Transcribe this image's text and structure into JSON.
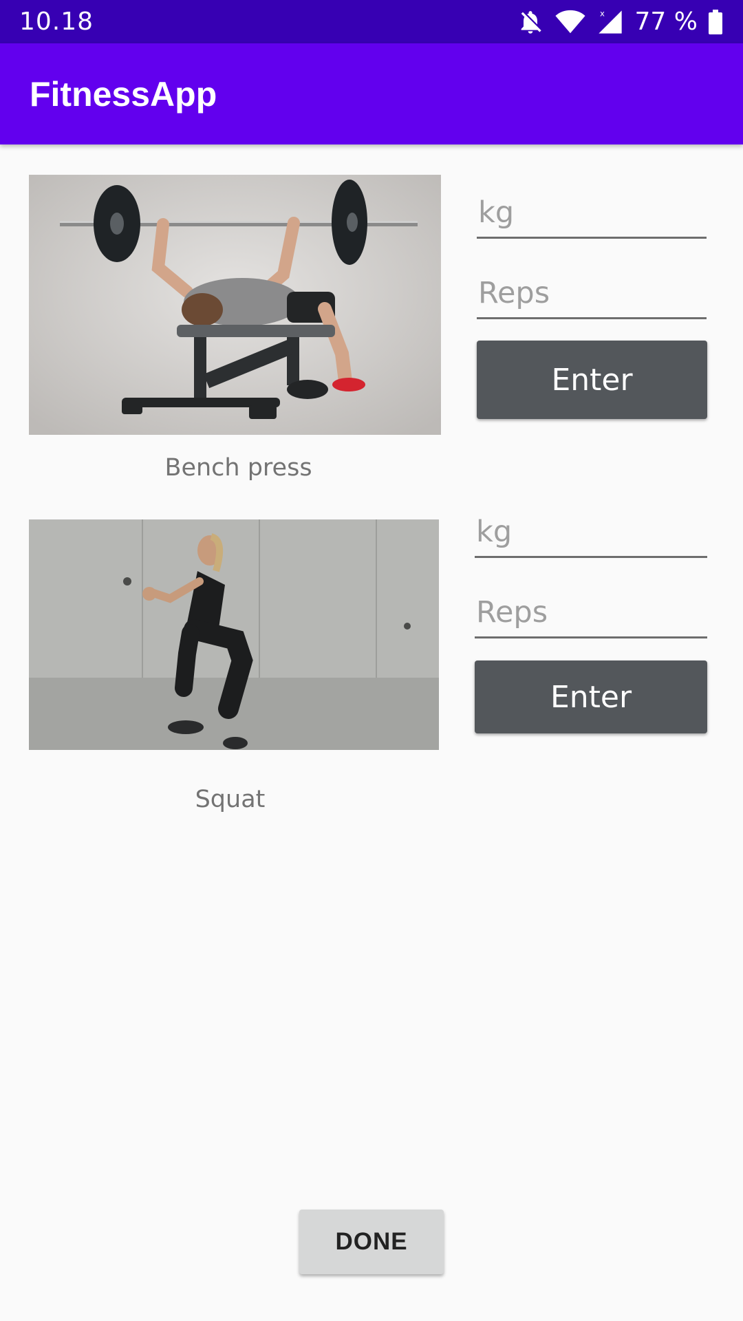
{
  "status_bar": {
    "time": "10.18",
    "battery": "77 %",
    "icons": [
      "notifications-off-icon",
      "wifi-icon",
      "cell-signal-icon",
      "battery-icon"
    ]
  },
  "app_bar": {
    "title": "FitnessApp"
  },
  "exercises": [
    {
      "name": "Bench press",
      "image_icon": "bench-press-photo",
      "weight_placeholder": "kg",
      "reps_placeholder": "Reps",
      "button_label": "Enter"
    },
    {
      "name": "Squat",
      "image_icon": "squat-photo",
      "weight_placeholder": "kg",
      "reps_placeholder": "Reps",
      "button_label": "Enter"
    }
  ],
  "done_label": "DONE",
  "colors": {
    "status_bar": "#3700b3",
    "app_bar": "#6200ee",
    "enter_button": "#53575b",
    "done_button": "#d6d7d7"
  }
}
